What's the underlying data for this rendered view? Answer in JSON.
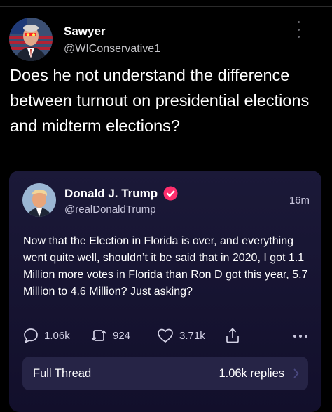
{
  "tweet": {
    "author_name": "Sawyer",
    "author_handle": "@WIConservative1",
    "text": "Does he not understand the difference between turnout on presidential elections and midterm elections?"
  },
  "quoted_tweet": {
    "author_name": "Donald J. Trump",
    "author_handle": "@realDonaldTrump",
    "time_ago": "16m",
    "text": "Now that the Election in Florida is over, and everything went quite well, shouldn’t it be said that in 2020, I got 1.1 Million more votes in Florida than Ron D got this year, 5.7 Million to 4.6 Million? Just asking?",
    "actions": {
      "replies": "1.06k",
      "retweets": "924",
      "likes": "3.71k"
    },
    "full_thread": {
      "label": "Full Thread",
      "replies_label": "1.06k replies"
    }
  },
  "icons": [
    "avatar-photo",
    "more-vertical-icon",
    "verified-badge-icon",
    "reply-icon",
    "retweet-icon",
    "like-icon",
    "share-icon",
    "more-horizontal-icon",
    "chevron-right-icon"
  ],
  "colors": {
    "background": "#000000",
    "card_background": "#1b1938",
    "thread_button_background": "#262446",
    "verified_badge": "#ff2e6d",
    "secondary_text": "#c8c6dc"
  }
}
